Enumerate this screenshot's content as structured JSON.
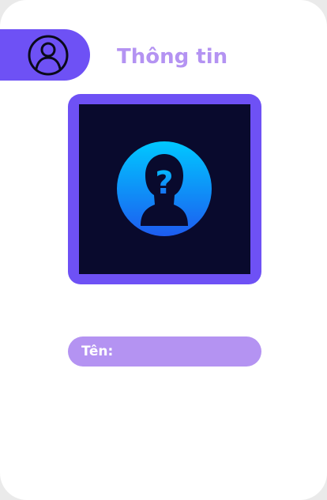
{
  "header": {
    "title": "Thông tin",
    "icon": "user-circle-icon"
  },
  "avatar": {
    "icon": "unknown-person-icon",
    "glyph": "?"
  },
  "profile": {
    "name_label": "Tên:",
    "name_value": ""
  },
  "colors": {
    "accent": "#6e51f5",
    "light_accent": "#b493f2",
    "avatar_background": "#090a2d",
    "avatar_gradient_top": "#00c8ff",
    "avatar_gradient_bottom": "#1d5cf0"
  }
}
